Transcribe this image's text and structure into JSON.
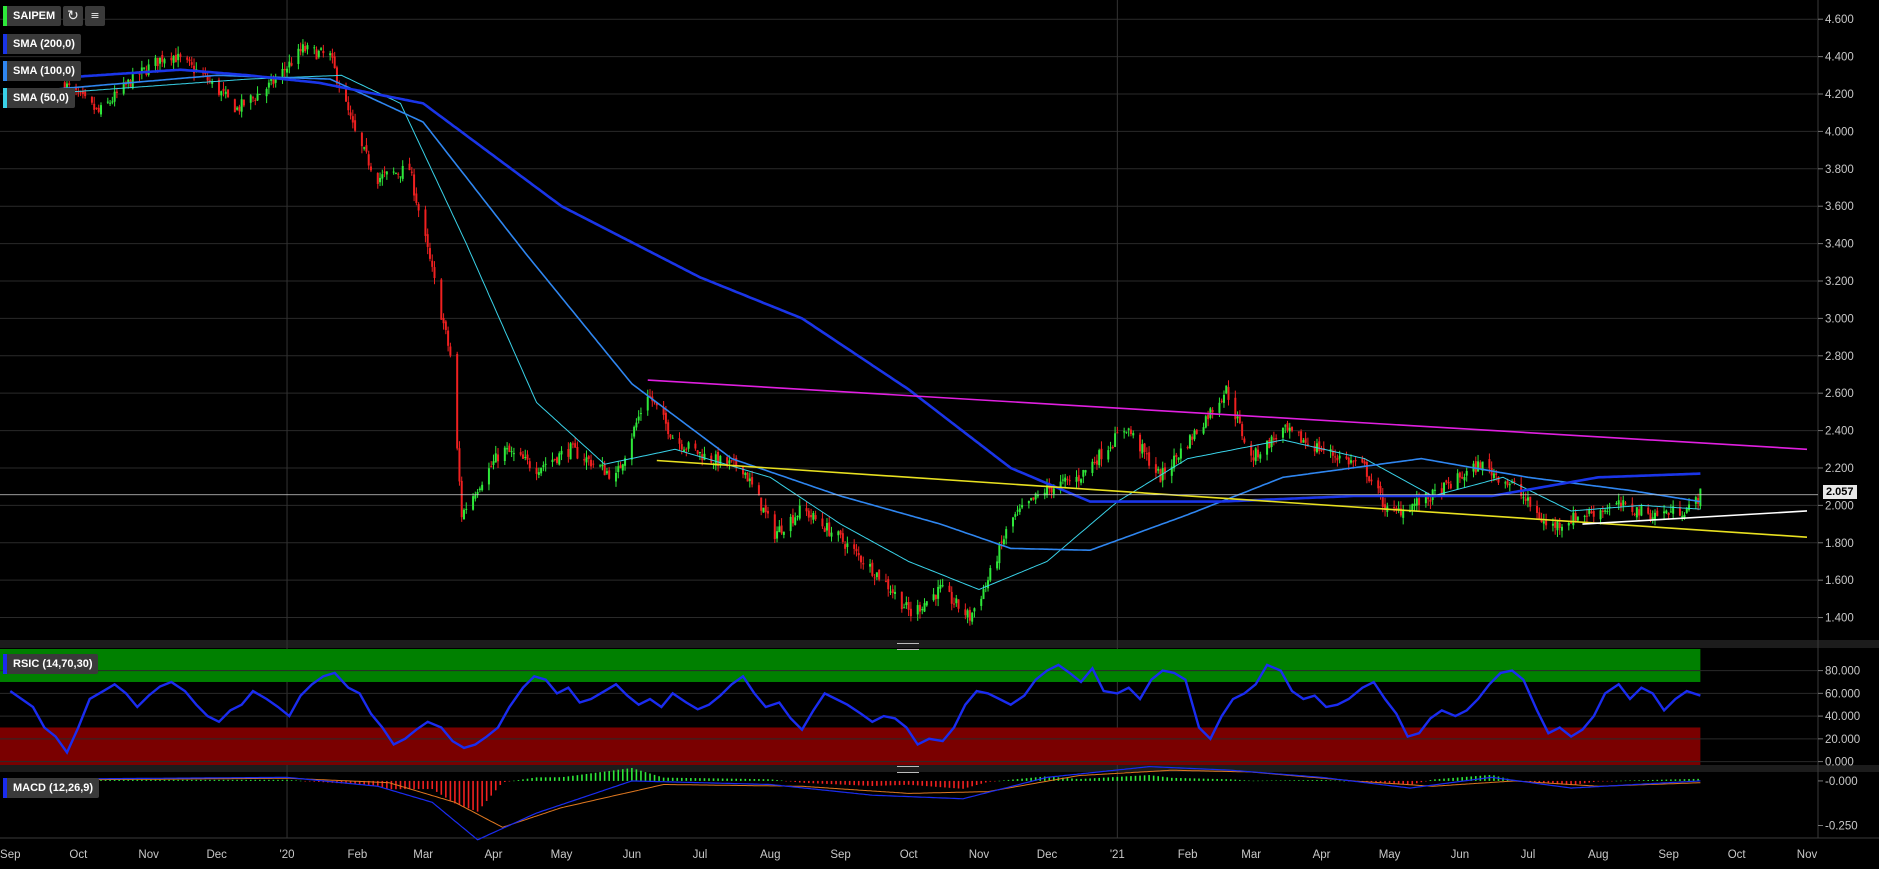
{
  "symbol": "SAIPEM",
  "icons": {
    "refresh": "refresh-icon",
    "settings": "ruler-icon"
  },
  "indicators": {
    "sma200": {
      "label": "SMA (200,0)",
      "color": "#1a35e8"
    },
    "sma100": {
      "label": "SMA (100,0)",
      "color": "#2f86f0"
    },
    "sma50": {
      "label": "SMA (50,0)",
      "color": "#39d2e8"
    },
    "rsi": {
      "label": "RSIC (14,70,30)",
      "color": "#1a2cf0"
    },
    "macd": {
      "label": "MACD (12,26,9)",
      "color": "#1a2cf0"
    }
  },
  "last_price": "2.057",
  "chart_data": [
    {
      "type": "candlestick",
      "title": "SAIPEM",
      "ylim": [
        1.28,
        4.66
      ],
      "y_ticks": [
        "4.600",
        "4.400",
        "4.200",
        "4.000",
        "3.800",
        "3.600",
        "3.400",
        "3.200",
        "3.000",
        "2.800",
        "2.600",
        "2.400",
        "2.200",
        "2.000",
        "1.800",
        "1.600",
        "1.400"
      ],
      "x_ticks": [
        "Sep",
        "Oct",
        "Nov",
        "Dec",
        "'20",
        "Feb",
        "Mar",
        "Apr",
        "May",
        "Jun",
        "Jul",
        "Aug",
        "Sep",
        "Oct",
        "Nov",
        "Dec",
        "'21",
        "Feb",
        "Mar",
        "Apr",
        "May",
        "Jun",
        "Jul",
        "Aug",
        "Sep",
        "Oct",
        "Nov"
      ],
      "close_path": [
        {
          "date": "2019-09-25",
          "v": 4.25
        },
        {
          "date": "2019-10-10",
          "v": 4.1
        },
        {
          "date": "2019-10-25",
          "v": 4.28
        },
        {
          "date": "2019-11-10",
          "v": 4.42
        },
        {
          "date": "2019-11-25",
          "v": 4.3
        },
        {
          "date": "2019-12-10",
          "v": 4.12
        },
        {
          "date": "2019-12-25",
          "v": 4.25
        },
        {
          "date": "2020-01-08",
          "v": 4.44
        },
        {
          "date": "2020-01-20",
          "v": 4.4
        },
        {
          "date": "2020-02-01",
          "v": 3.95
        },
        {
          "date": "2020-02-10",
          "v": 3.75
        },
        {
          "date": "2020-02-24",
          "v": 3.8
        },
        {
          "date": "2020-03-05",
          "v": 3.25
        },
        {
          "date": "2020-03-13",
          "v": 2.8
        },
        {
          "date": "2020-03-18",
          "v": 1.95
        },
        {
          "date": "2020-03-25",
          "v": 2.1
        },
        {
          "date": "2020-04-05",
          "v": 2.3
        },
        {
          "date": "2020-04-20",
          "v": 2.2
        },
        {
          "date": "2020-05-05",
          "v": 2.3
        },
        {
          "date": "2020-05-25",
          "v": 2.15
        },
        {
          "date": "2020-06-08",
          "v": 2.6
        },
        {
          "date": "2020-06-20",
          "v": 2.35
        },
        {
          "date": "2020-07-05",
          "v": 2.25
        },
        {
          "date": "2020-07-20",
          "v": 2.2
        },
        {
          "date": "2020-08-03",
          "v": 1.85
        },
        {
          "date": "2020-08-15",
          "v": 1.98
        },
        {
          "date": "2020-09-01",
          "v": 1.82
        },
        {
          "date": "2020-09-20",
          "v": 1.6
        },
        {
          "date": "2020-10-02",
          "v": 1.42
        },
        {
          "date": "2020-10-15",
          "v": 1.55
        },
        {
          "date": "2020-10-28",
          "v": 1.4
        },
        {
          "date": "2020-11-05",
          "v": 1.6
        },
        {
          "date": "2020-11-15",
          "v": 1.92
        },
        {
          "date": "2020-11-30",
          "v": 2.08
        },
        {
          "date": "2020-12-15",
          "v": 2.15
        },
        {
          "date": "2021-01-05",
          "v": 2.42
        },
        {
          "date": "2021-01-20",
          "v": 2.15
        },
        {
          "date": "2021-02-05",
          "v": 2.4
        },
        {
          "date": "2021-02-18",
          "v": 2.62
        },
        {
          "date": "2021-03-01",
          "v": 2.25
        },
        {
          "date": "2021-03-15",
          "v": 2.4
        },
        {
          "date": "2021-04-01",
          "v": 2.3
        },
        {
          "date": "2021-04-20",
          "v": 2.2
        },
        {
          "date": "2021-05-01",
          "v": 1.95
        },
        {
          "date": "2021-05-20",
          "v": 2.05
        },
        {
          "date": "2021-06-10",
          "v": 2.22
        },
        {
          "date": "2021-06-25",
          "v": 2.1
        },
        {
          "date": "2021-07-10",
          "v": 1.88
        },
        {
          "date": "2021-07-25",
          "v": 1.95
        },
        {
          "date": "2021-08-10",
          "v": 2.0
        },
        {
          "date": "2021-08-25",
          "v": 1.95
        },
        {
          "date": "2021-09-10",
          "v": 1.98
        },
        {
          "date": "2021-09-15",
          "v": 2.057
        }
      ],
      "sma200": [
        {
          "date": "2019-09-15",
          "v": 4.28
        },
        {
          "date": "2019-11-15",
          "v": 4.33
        },
        {
          "date": "2019-12-15",
          "v": 4.3
        },
        {
          "date": "2020-01-15",
          "v": 4.26
        },
        {
          "date": "2020-03-01",
          "v": 4.15
        },
        {
          "date": "2020-05-01",
          "v": 3.6
        },
        {
          "date": "2020-07-01",
          "v": 3.22
        },
        {
          "date": "2020-08-15",
          "v": 3.0
        },
        {
          "date": "2020-10-01",
          "v": 2.62
        },
        {
          "date": "2020-11-15",
          "v": 2.2
        },
        {
          "date": "2020-12-20",
          "v": 2.02
        },
        {
          "date": "2021-02-15",
          "v": 2.02
        },
        {
          "date": "2021-04-15",
          "v": 2.05
        },
        {
          "date": "2021-06-15",
          "v": 2.05
        },
        {
          "date": "2021-08-01",
          "v": 2.15
        },
        {
          "date": "2021-09-15",
          "v": 2.17
        }
      ],
      "sma100": [
        {
          "date": "2019-09-15",
          "v": 4.22
        },
        {
          "date": "2019-12-01",
          "v": 4.3
        },
        {
          "date": "2020-01-20",
          "v": 4.28
        },
        {
          "date": "2020-03-01",
          "v": 4.05
        },
        {
          "date": "2020-04-15",
          "v": 3.35
        },
        {
          "date": "2020-06-01",
          "v": 2.65
        },
        {
          "date": "2020-07-15",
          "v": 2.25
        },
        {
          "date": "2020-09-01",
          "v": 2.05
        },
        {
          "date": "2020-10-15",
          "v": 1.9
        },
        {
          "date": "2020-11-15",
          "v": 1.77
        },
        {
          "date": "2020-12-20",
          "v": 1.76
        },
        {
          "date": "2021-02-01",
          "v": 1.95
        },
        {
          "date": "2021-03-15",
          "v": 2.15
        },
        {
          "date": "2021-05-15",
          "v": 2.25
        },
        {
          "date": "2021-07-01",
          "v": 2.15
        },
        {
          "date": "2021-08-15",
          "v": 2.08
        },
        {
          "date": "2021-09-15",
          "v": 2.02
        }
      ],
      "sma50": [
        {
          "date": "2019-09-15",
          "v": 4.2
        },
        {
          "date": "2019-12-15",
          "v": 4.28
        },
        {
          "date": "2020-01-25",
          "v": 4.3
        },
        {
          "date": "2020-02-20",
          "v": 4.15
        },
        {
          "date": "2020-03-20",
          "v": 3.4
        },
        {
          "date": "2020-04-20",
          "v": 2.55
        },
        {
          "date": "2020-05-20",
          "v": 2.22
        },
        {
          "date": "2020-06-20",
          "v": 2.3
        },
        {
          "date": "2020-08-01",
          "v": 2.15
        },
        {
          "date": "2020-09-01",
          "v": 1.9
        },
        {
          "date": "2020-10-01",
          "v": 1.7
        },
        {
          "date": "2020-11-01",
          "v": 1.55
        },
        {
          "date": "2020-12-01",
          "v": 1.7
        },
        {
          "date": "2021-01-01",
          "v": 2.02
        },
        {
          "date": "2021-02-01",
          "v": 2.25
        },
        {
          "date": "2021-03-15",
          "v": 2.35
        },
        {
          "date": "2021-04-20",
          "v": 2.25
        },
        {
          "date": "2021-05-20",
          "v": 2.05
        },
        {
          "date": "2021-06-20",
          "v": 2.15
        },
        {
          "date": "2021-07-20",
          "v": 1.97
        },
        {
          "date": "2021-08-20",
          "v": 2.0
        },
        {
          "date": "2021-09-15",
          "v": 1.98
        }
      ],
      "trendlines": [
        {
          "color": "#e020e0",
          "from": {
            "date": "2020-06-08",
            "v": 2.67
          },
          "to": {
            "date": "2021-11-01",
            "v": 2.3
          }
        },
        {
          "color": "#e8e020",
          "from": {
            "date": "2020-06-12",
            "v": 2.24
          },
          "to": {
            "date": "2021-11-01",
            "v": 1.83
          }
        },
        {
          "color": "#ffffff",
          "from": {
            "date": "2021-07-25",
            "v": 1.9
          },
          "to": {
            "date": "2021-11-01",
            "v": 1.97
          }
        }
      ],
      "hline": 2.057
    },
    {
      "type": "line",
      "title": "RSIC (14,70,30)",
      "ylim": [
        -3,
        99
      ],
      "y_ticks": [
        "80.000",
        "60.000",
        "40.000",
        "20.000",
        "0.000"
      ],
      "bands": {
        "overbought": 70,
        "oversold": 30
      },
      "series": [
        {
          "name": "RSI",
          "values": [
            62,
            55,
            48,
            30,
            22,
            8,
            30,
            55,
            62,
            68,
            60,
            48,
            58,
            66,
            70,
            62,
            50,
            40,
            35,
            45,
            50,
            62,
            55,
            48,
            40,
            58,
            68,
            75,
            78,
            65,
            60,
            42,
            30,
            15,
            20,
            28,
            35,
            30,
            18,
            12,
            15,
            22,
            30,
            48,
            65,
            75,
            72,
            60,
            65,
            52,
            55,
            62,
            68,
            58,
            50,
            55,
            48,
            60,
            52,
            46,
            50,
            58,
            68,
            75,
            60,
            48,
            52,
            38,
            28,
            45,
            60,
            55,
            50,
            42,
            35,
            40,
            38,
            30,
            15,
            20,
            18,
            30,
            50,
            62,
            60,
            55,
            50,
            58,
            72,
            80,
            85,
            78,
            70,
            82,
            62,
            60,
            65,
            55,
            72,
            80,
            78,
            72,
            30,
            20,
            40,
            55,
            60,
            68,
            85,
            80,
            62,
            55,
            58,
            48,
            50,
            55,
            65,
            70,
            55,
            42,
            22,
            25,
            38,
            45,
            40,
            45,
            55,
            68,
            78,
            80,
            72,
            45,
            25,
            30,
            22,
            28,
            40,
            60,
            68,
            55,
            65,
            60,
            45,
            55,
            62,
            58
          ]
        }
      ]
    },
    {
      "type": "bar",
      "title": "MACD (12,26,9)",
      "ylim": [
        -0.32,
        0.05
      ],
      "y_ticks": [
        "-0.000",
        "-0.250"
      ],
      "macd": [
        {
          "date": "2019-09-15",
          "v": 0.01
        },
        {
          "date": "2020-01-01",
          "v": 0.02
        },
        {
          "date": "2020-02-10",
          "v": -0.03
        },
        {
          "date": "2020-03-05",
          "v": -0.12
        },
        {
          "date": "2020-03-25",
          "v": -0.33
        },
        {
          "date": "2020-04-20",
          "v": -0.18
        },
        {
          "date": "2020-06-01",
          "v": 0.0
        },
        {
          "date": "2020-08-01",
          "v": -0.02
        },
        {
          "date": "2020-09-15",
          "v": -0.08
        },
        {
          "date": "2020-10-25",
          "v": -0.1
        },
        {
          "date": "2020-12-01",
          "v": 0.02
        },
        {
          "date": "2021-01-15",
          "v": 0.08
        },
        {
          "date": "2021-02-20",
          "v": 0.06
        },
        {
          "date": "2021-04-01",
          "v": 0.02
        },
        {
          "date": "2021-05-10",
          "v": -0.04
        },
        {
          "date": "2021-06-15",
          "v": 0.02
        },
        {
          "date": "2021-07-20",
          "v": -0.04
        },
        {
          "date": "2021-09-15",
          "v": 0.0
        }
      ],
      "signal": [
        {
          "date": "2019-09-15",
          "v": 0.005
        },
        {
          "date": "2020-01-01",
          "v": 0.015
        },
        {
          "date": "2020-02-15",
          "v": -0.01
        },
        {
          "date": "2020-03-15",
          "v": -0.12
        },
        {
          "date": "2020-04-05",
          "v": -0.26
        },
        {
          "date": "2020-05-01",
          "v": -0.15
        },
        {
          "date": "2020-06-15",
          "v": -0.02
        },
        {
          "date": "2020-08-15",
          "v": -0.03
        },
        {
          "date": "2020-10-01",
          "v": -0.07
        },
        {
          "date": "2020-11-05",
          "v": -0.06
        },
        {
          "date": "2020-12-15",
          "v": 0.03
        },
        {
          "date": "2021-01-25",
          "v": 0.06
        },
        {
          "date": "2021-03-01",
          "v": 0.05
        },
        {
          "date": "2021-04-15",
          "v": 0.0
        },
        {
          "date": "2021-05-20",
          "v": -0.03
        },
        {
          "date": "2021-06-25",
          "v": 0.0
        },
        {
          "date": "2021-08-01",
          "v": -0.03
        },
        {
          "date": "2021-09-15",
          "v": -0.01
        }
      ]
    }
  ],
  "colors": {
    "up": "#2ee83a",
    "down": "#f02020",
    "grid": "#2a2a2a",
    "overbought": "#008000",
    "oversold": "#7a0000"
  }
}
